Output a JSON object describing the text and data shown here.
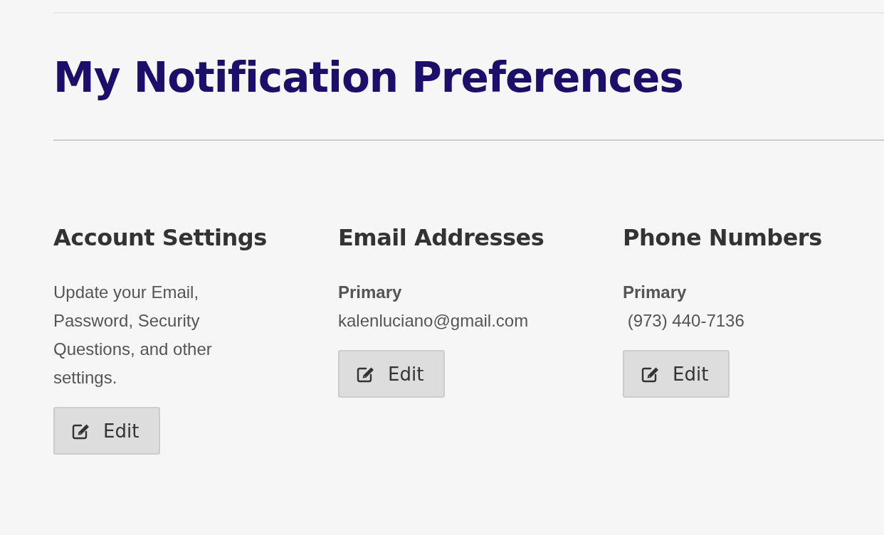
{
  "page": {
    "title": "My Notification Preferences"
  },
  "sections": [
    {
      "kind": "description",
      "heading": "Account Settings",
      "text": "Update your Email, Password, Security Questions, and other settings.",
      "button": "Edit"
    },
    {
      "kind": "contact",
      "heading": "Email Addresses",
      "label": "Primary",
      "value": "kalenluciano@gmail.com",
      "button": "Edit"
    },
    {
      "kind": "contact",
      "heading": "Phone Numbers",
      "label": "Primary",
      "value": " (973) 440-7136",
      "button": "Edit"
    }
  ]
}
